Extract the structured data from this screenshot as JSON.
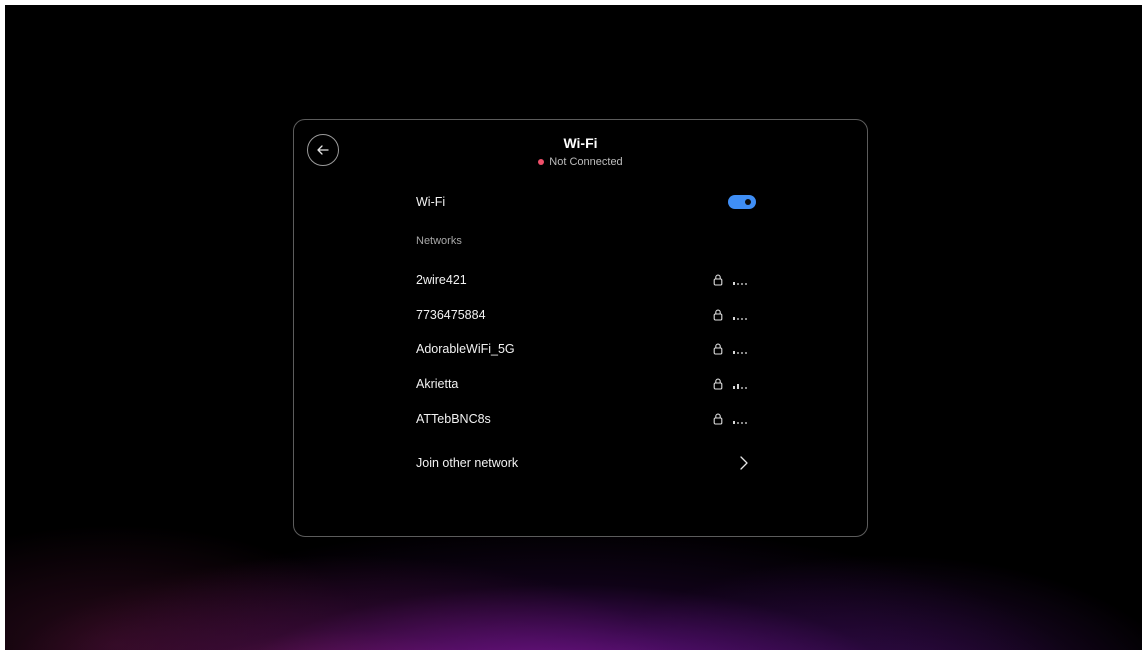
{
  "header": {
    "title": "Wi-Fi",
    "status": "Not Connected",
    "status_color": "#f0506a"
  },
  "wifi_toggle": {
    "label": "Wi-Fi",
    "enabled": true,
    "accent": "#3f8ef5"
  },
  "networks": {
    "section_label": "Networks",
    "items": [
      {
        "name": "2wire421",
        "secured": true,
        "icon": "lock-icon",
        "signal_bars": 1
      },
      {
        "name": "7736475884",
        "secured": true,
        "icon": "lock-icon",
        "signal_bars": 1
      },
      {
        "name": "AdorableWiFi_5G",
        "secured": true,
        "icon": "lock-icon",
        "signal_bars": 1
      },
      {
        "name": "Akrietta",
        "secured": true,
        "icon": "lock-icon",
        "signal_bars": 2
      },
      {
        "name": "ATTebBNC8s",
        "secured": true,
        "icon": "lock-icon",
        "signal_bars": 1
      }
    ]
  },
  "join_other": {
    "label": "Join other network",
    "icon": "chevron-right-icon"
  },
  "icons": {
    "back": "arrow-left-icon"
  }
}
